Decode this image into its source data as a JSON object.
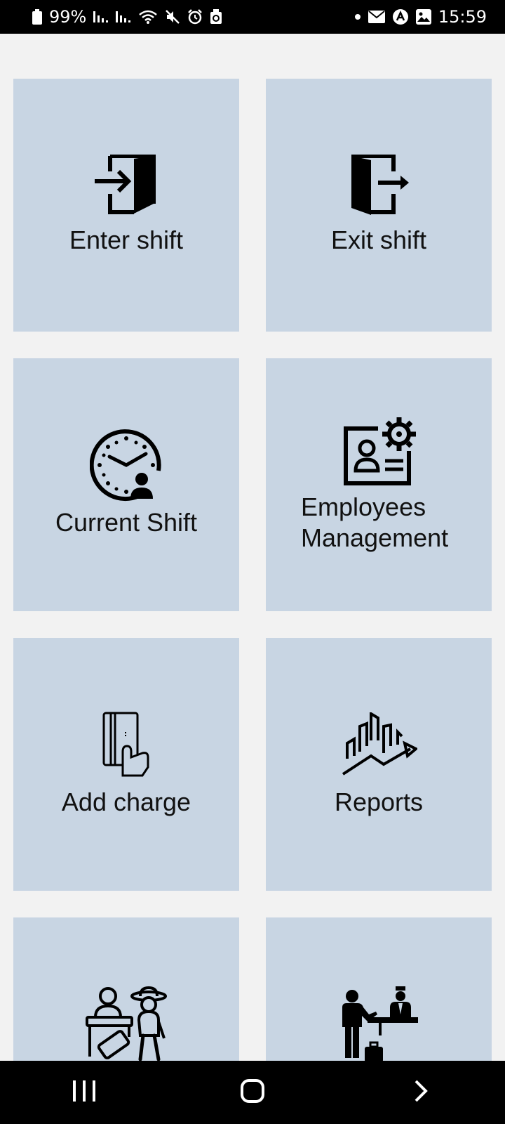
{
  "status_bar": {
    "battery": "99%",
    "time": "15:59",
    "left_icons": [
      "battery-icon",
      "signal-icon",
      "signal-icon",
      "wifi-icon",
      "mute-icon",
      "alarm-icon",
      "recycle-icon"
    ],
    "right_icons": [
      "dot-icon",
      "mail-icon",
      "app-icon",
      "image-icon"
    ]
  },
  "tiles": [
    {
      "label": "Enter shift",
      "icon": "enter-door-icon"
    },
    {
      "label": "Exit shift",
      "icon": "exit-door-icon"
    },
    {
      "label": "Current Shift",
      "icon": "clock-user-icon"
    },
    {
      "label_line1": "Employees",
      "label_line2": "Management",
      "icon": "employee-card-gear-icon"
    },
    {
      "label": "Add charge",
      "icon": "card-hand-icon"
    },
    {
      "label": "Reports",
      "icon": "chart-growth-icon"
    },
    {
      "label": "",
      "icon": "reception-tourist-icon"
    },
    {
      "label": "",
      "icon": "hotel-reception-icon"
    }
  ],
  "nav_bar": {
    "recents": "recents-icon",
    "home": "home-icon",
    "back": "back-icon"
  },
  "colors": {
    "tile_bg": "#c8d5e3",
    "page_bg": "#f2f2f2",
    "bars": "#000000"
  }
}
